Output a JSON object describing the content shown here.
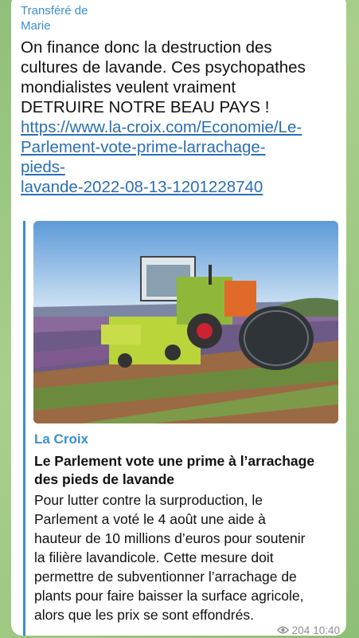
{
  "message": {
    "forwarded_from": [
      "Transféré de",
      "Marie"
    ],
    "text_lines": [
      "On finance donc la destruction des",
      "cultures de lavande. Ces psychopathes",
      "mondialistes veulent vraiment",
      "DETRUIRE NOTRE BEAU PAYS !"
    ],
    "link_lines": [
      "https://www.la-croix.com/Economie/Le-",
      "Parlement-vote-prime-larrachage-",
      "pieds-",
      "lavande-2022-08-13-1201228740"
    ],
    "views": "204",
    "time": "10:40"
  },
  "preview": {
    "site": "La Croix",
    "title_lines": [
      "Le Parlement vote une prime à l’arrachage",
      "des pieds de lavande"
    ],
    "desc_lines": [
      "Pour lutter contre la surproduction, le",
      "Parlement a voté le 4 août une aide à",
      "hauteur de 10 millions d’euros pour soutenir",
      "la filière lavandicole. Cette mesure doit",
      "permettre de subventionner l’arrachage de",
      "plants pour faire baisser la surface agricole,",
      "alors que les prix se sont effondrés."
    ]
  }
}
